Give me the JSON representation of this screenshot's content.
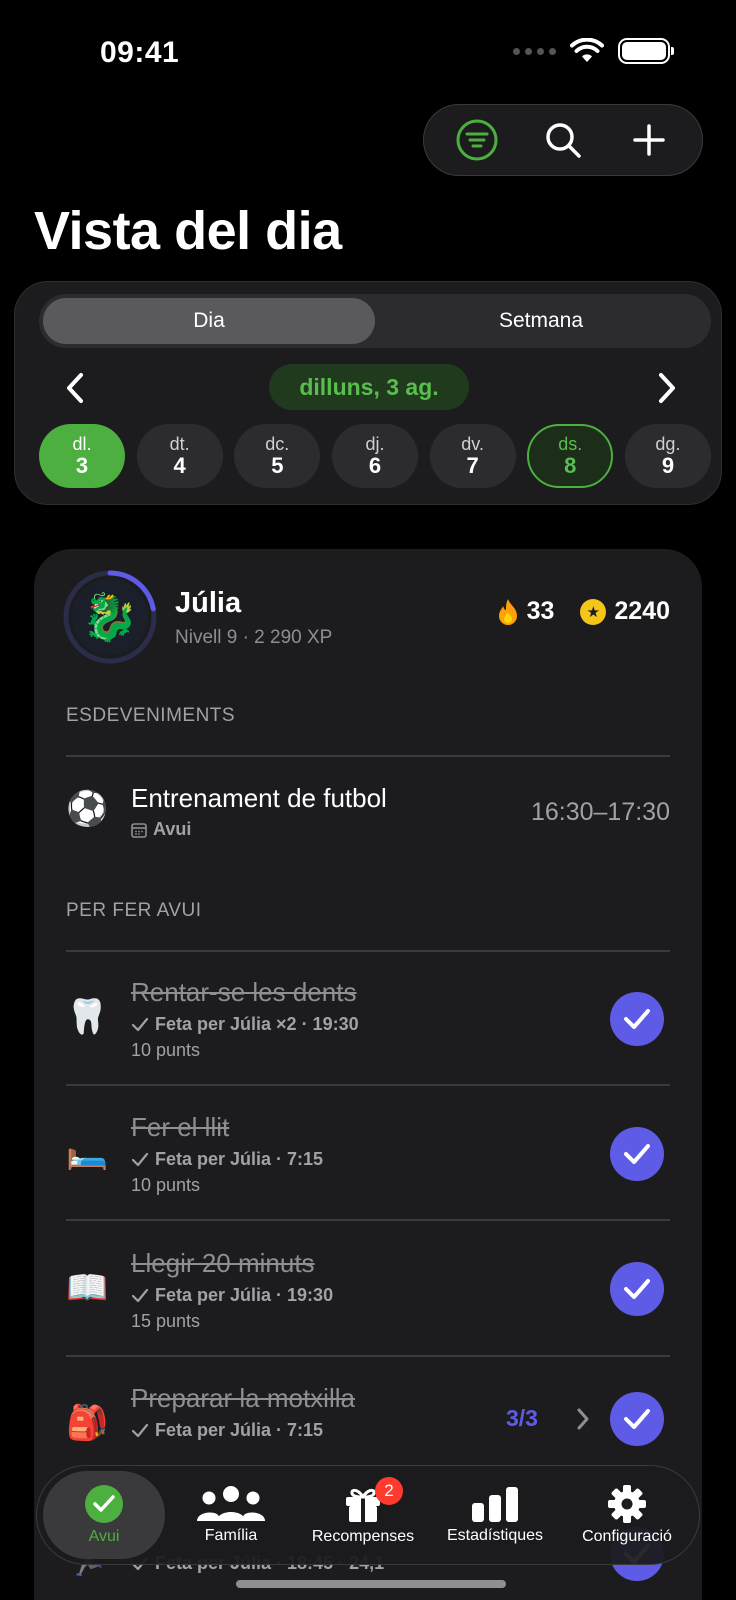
{
  "status_bar": {
    "time": "09:41"
  },
  "header": {
    "title": "Vista del dia"
  },
  "view_toggle": {
    "options": [
      "Dia",
      "Setmana"
    ],
    "selected": "Dia"
  },
  "date_nav": {
    "current_label": "dilluns, 3 ag.",
    "days": [
      {
        "name": "dl.",
        "num": "3",
        "state": "selected"
      },
      {
        "name": "dt.",
        "num": "4",
        "state": "normal"
      },
      {
        "name": "dc.",
        "num": "5",
        "state": "normal"
      },
      {
        "name": "dj.",
        "num": "6",
        "state": "normal"
      },
      {
        "name": "dv.",
        "num": "7",
        "state": "normal"
      },
      {
        "name": "ds.",
        "num": "8",
        "state": "today"
      },
      {
        "name": "dg.",
        "num": "9",
        "state": "normal"
      }
    ]
  },
  "profile": {
    "name": "Júlia",
    "level": "Nivell 9 · 2 290 XP",
    "avatar_icon": "dragon-icon",
    "level_progress": 0.22,
    "streak": "33",
    "coins": "2240"
  },
  "events": {
    "section_label": "ESDEVENIMENTS",
    "items": [
      {
        "icon": "⚽",
        "title": "Entrenament de futbol",
        "sub": "Avui",
        "time": "16:30–17:30"
      }
    ]
  },
  "tasks": {
    "section_label": "PER FER AVUI",
    "items": [
      {
        "icon": "🦷",
        "title": "Rentar-se les dents",
        "sub": "Feta per Júlia ×2 · 19:30",
        "points": "10 punts",
        "done": true
      },
      {
        "icon": "🛏️",
        "title": "Fer el llit",
        "sub": "Feta per Júlia · 7:15",
        "points": "10 punts",
        "done": true
      },
      {
        "icon": "📖",
        "title": "Llegir 20 minuts",
        "sub": "Feta per Júlia · 19:30",
        "points": "15 punts",
        "done": true
      },
      {
        "icon": "🎒",
        "title": "Preparar la motxilla",
        "sub": "Feta per Júlia · 7:15",
        "progress": "3/3",
        "done": true
      },
      {
        "icon": "🏃",
        "sub": "Feta per Júlia · 18:45 · 24,1",
        "done": true
      }
    ]
  },
  "tab_bar": {
    "items": [
      {
        "label": "Avui",
        "icon": "check-circle-icon",
        "active": true
      },
      {
        "label": "Família",
        "icon": "people-icon"
      },
      {
        "label": "Recompenses",
        "icon": "gift-icon",
        "badge": "2"
      },
      {
        "label": "Estadístiques",
        "icon": "bar-chart-icon"
      },
      {
        "label": "Configuració",
        "icon": "gear-icon"
      }
    ]
  },
  "colors": {
    "accent_green": "#4caf3f",
    "accent_purple": "#5e5ce6",
    "background": "#000000",
    "card": "#1c1c1e"
  }
}
